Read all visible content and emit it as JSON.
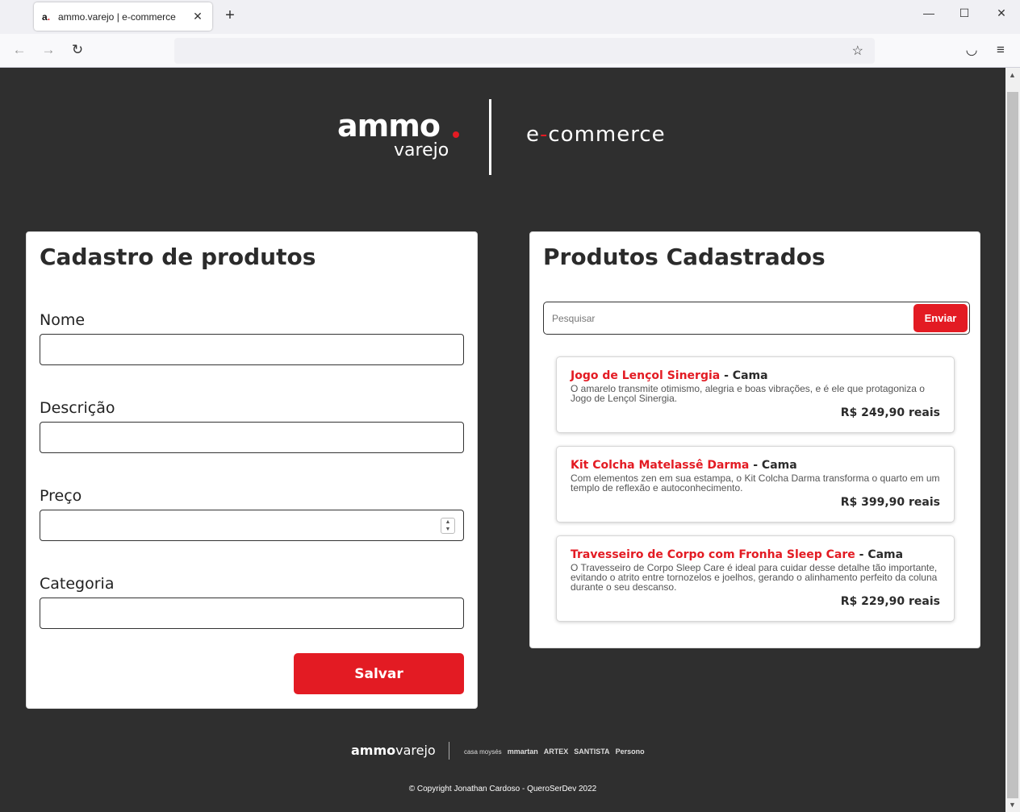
{
  "browser": {
    "tab_favicon": "a.",
    "tab_title": "ammo.varejo | e-commerce",
    "tab_close": "✕",
    "new_tab": "+",
    "minimize": "—",
    "maximize": "☐",
    "close": "✕",
    "back": "←",
    "forward": "→",
    "reload": "↻",
    "bookmark": "☆",
    "pocket": "◡",
    "menu": "≡"
  },
  "header": {
    "logo_main": "ammo",
    "logo_sub": "varejo",
    "ecommerce_prefix": "e",
    "ecommerce_dash": "-",
    "ecommerce_suffix": "commerce"
  },
  "form": {
    "title": "Cadastro de produtos",
    "fields": [
      {
        "label": "Nome",
        "value": ""
      },
      {
        "label": "Descrição",
        "value": ""
      },
      {
        "label": "Preço",
        "value": ""
      },
      {
        "label": "Categoria",
        "value": ""
      }
    ],
    "save_label": "Salvar"
  },
  "list": {
    "title": "Produtos Cadastrados",
    "search_placeholder": "Pesquisar",
    "send_label": "Enviar",
    "products": [
      {
        "name": "Jogo de Lençol Sinergia",
        "category": " - Cama",
        "description": "O amarelo transmite otimismo, alegria e boas vibrações, e é ele que protagoniza o Jogo de Lençol Sinergia.",
        "price": "R$ 249,90 reais"
      },
      {
        "name": "Kit Colcha Matelassê Darma",
        "category": " - Cama",
        "description": "Com elementos zen em sua estampa, o Kit Colcha Darma transforma o quarto em um templo de reflexão e autoconhecimento.",
        "price": "R$ 399,90 reais"
      },
      {
        "name": "Travesseiro de Corpo com Fronha Sleep Care",
        "category": " - Cama",
        "description": "O Travesseiro de Corpo Sleep Care é ideal para cuidar desse detalhe tão importante, evitando o atrito entre tornozelos e joelhos, gerando o alinhamento perfeito da coluna durante o seu descanso.",
        "price": "R$ 229,90 reais"
      }
    ]
  },
  "footer": {
    "logo_main": "ammo",
    "logo_sub": "varejo",
    "brands": [
      "casa moysés",
      "mmartan",
      "ARTEX",
      "SANTISTA",
      "Persono"
    ],
    "copyright": "© Copyright Jonathan Cardoso - QueroSerDev 2022"
  },
  "colors": {
    "accent": "#e31b23",
    "background": "#2f2f2f"
  }
}
